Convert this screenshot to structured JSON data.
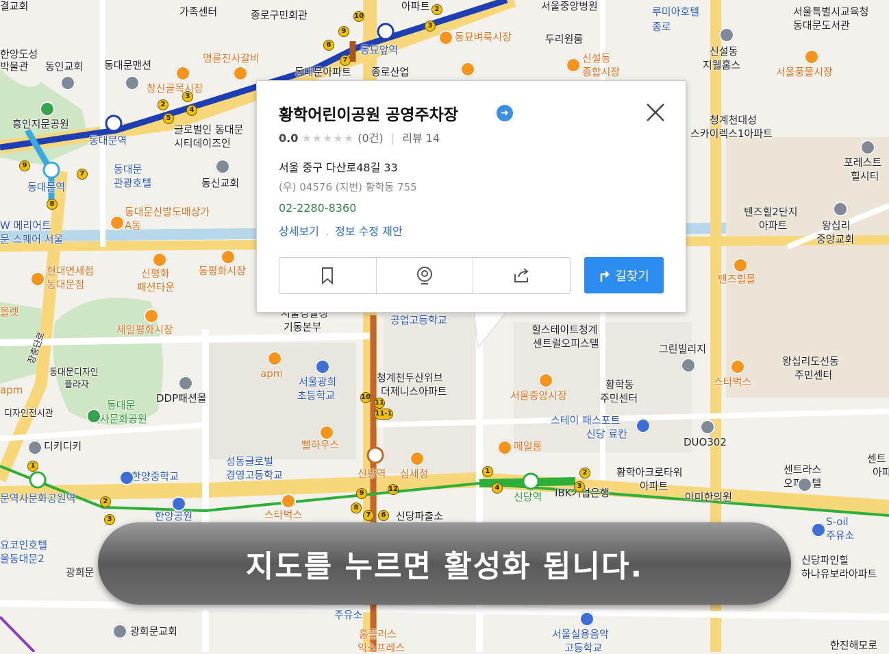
{
  "popup": {
    "title": "황학어린이공원 공영주차장",
    "rating": "0.0",
    "stars": "★★★★★",
    "rating_count": "(0건)",
    "review": "리뷰 14",
    "address": "서울 중구 다산로48길 33",
    "postal": "(우) 04576   (지번) 황학동 755",
    "phone": "02-2280-8360",
    "detail_link": "상세보기",
    "suggest_link": "정보 수정 제안",
    "route_label": "길찾기"
  },
  "overlay": {
    "message": "지도를 누르면 활성화 됩니다."
  },
  "map": {
    "colors": {
      "line1": "#1e3fb3",
      "line2": "#2eaf3a",
      "line4": "#3aa9e0",
      "line6": "#a9561e",
      "road_major": "#f6d77a",
      "road": "#ffffff"
    },
    "labels": [
      {
        "text": "결교회"
      },
      {
        "text": "가족센터"
      },
      {
        "text": "종로구민회관"
      },
      {
        "text": "아파트"
      },
      {
        "text": "서울중앙병원"
      },
      {
        "text": "루미아호텔"
      },
      {
        "text": "종로"
      },
      {
        "text": "서울특별시교육청"
      },
      {
        "text": "동대문도서관"
      },
      {
        "text": "한양도성"
      },
      {
        "text": "박물관"
      },
      {
        "text": "동인교회"
      },
      {
        "text": "동대문맨션"
      },
      {
        "text": "명륜진사갈비"
      },
      {
        "text": "동묘앞역"
      },
      {
        "text": "동묘벼룩시장"
      },
      {
        "text": "두리원룸"
      },
      {
        "text": "신설동"
      },
      {
        "text": "종합시장"
      },
      {
        "text": "신설동"
      },
      {
        "text": "지웰홈스"
      },
      {
        "text": "서울풍물시장"
      },
      {
        "text": "동대문아파트"
      },
      {
        "text": "종로산업"
      },
      {
        "text": "창신골목시장"
      },
      {
        "text": "흥인지문공원"
      },
      {
        "text": "동대문역"
      },
      {
        "text": "글로벌인 동대문"
      },
      {
        "text": "시티데이즈인"
      },
      {
        "text": "청계천대성"
      },
      {
        "text": "스카이렉스1아파트"
      },
      {
        "text": "동대문역"
      },
      {
        "text": "동대문"
      },
      {
        "text": "관광호텔"
      },
      {
        "text": "동신교회"
      },
      {
        "text": "포레스트"
      },
      {
        "text": "힐시티"
      },
      {
        "text": "동대문신발도매상가"
      },
      {
        "text": "A동"
      },
      {
        "text": "W 메리어트"
      },
      {
        "text": "문 스퀘어 서울"
      },
      {
        "text": "텐즈힐2단지"
      },
      {
        "text": "아파트"
      },
      {
        "text": "왕십리"
      },
      {
        "text": "중앙교회"
      },
      {
        "text": "현대면세점"
      },
      {
        "text": "동대문점"
      },
      {
        "text": "신평화"
      },
      {
        "text": "패션타운"
      },
      {
        "text": "동평화시장"
      },
      {
        "text": "텐즈힐몰"
      },
      {
        "text": "제일평화시장"
      },
      {
        "text": "서울경찰청"
      },
      {
        "text": "기동본부"
      },
      {
        "text": "공업고등학교"
      },
      {
        "text": "힐스테이트청계"
      },
      {
        "text": "센트럴오피스텔"
      },
      {
        "text": "그린빌리지"
      },
      {
        "text": "왕십리도선동"
      },
      {
        "text": "주민센터"
      },
      {
        "text": "동대문디자인"
      },
      {
        "text": "플라자"
      },
      {
        "text": "apm"
      },
      {
        "text": "서울광희"
      },
      {
        "text": "초등학교"
      },
      {
        "text": "청계천두산위브"
      },
      {
        "text": "더제니스아파트"
      },
      {
        "text": "서울중앙시장"
      },
      {
        "text": "황학동"
      },
      {
        "text": "주민센터"
      },
      {
        "text": "스타벅스"
      },
      {
        "text": "동대문"
      },
      {
        "text": "역사문화공원"
      },
      {
        "text": "DDP패션몰"
      },
      {
        "text": "디자인전시관"
      },
      {
        "text": "스테이 패스포트"
      },
      {
        "text": "신당 료칸"
      },
      {
        "text": "DUO302"
      },
      {
        "text": "디키디키"
      },
      {
        "text": "뻘하우스"
      },
      {
        "text": "메일룸"
      },
      {
        "text": "성동글로벌"
      },
      {
        "text": "경영고등학교"
      },
      {
        "text": "한양중학교"
      },
      {
        "text": "신당역"
      },
      {
        "text": "심세정"
      },
      {
        "text": "신당역"
      },
      {
        "text": "IBK기업은행"
      },
      {
        "text": "황학아크로타워"
      },
      {
        "text": "아파트"
      },
      {
        "text": "아미한의원"
      },
      {
        "text": "센트라스"
      },
      {
        "text": "오피스텔"
      },
      {
        "text": "센트"
      },
      {
        "text": "아파"
      },
      {
        "text": "문역사문화공원역"
      },
      {
        "text": "한양공원"
      },
      {
        "text": "스타벅스"
      },
      {
        "text": "신당파출소"
      },
      {
        "text": "S-oil"
      },
      {
        "text": "주유소"
      },
      {
        "text": "요코인호텔"
      },
      {
        "text": "울동대문2"
      },
      {
        "text": "광희문"
      },
      {
        "text": "신당파인힐"
      },
      {
        "text": "하나유보라아파트"
      },
      {
        "text": "광희문교회"
      },
      {
        "text": "주유소"
      },
      {
        "text": "홈플러스"
      },
      {
        "text": "익스프레스"
      },
      {
        "text": "서울실용음악"
      },
      {
        "text": "고등학교"
      },
      {
        "text": "한진해모로"
      },
      {
        "text": "장충단로"
      },
      {
        "text": "apm"
      },
      {
        "text": "올렛"
      }
    ]
  }
}
